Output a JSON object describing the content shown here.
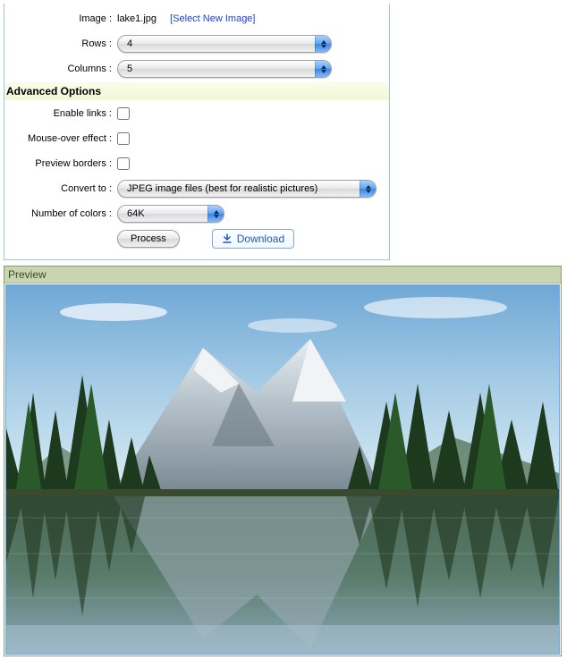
{
  "labels": {
    "image": "Image :",
    "rows": "Rows :",
    "columns": "Columns :",
    "advanced": "Advanced Options",
    "enable_links": "Enable links :",
    "mouseover": "Mouse-over effect :",
    "preview_borders": "Preview borders :",
    "convert_to": "Convert to :",
    "num_colors": "Number of colors :"
  },
  "values": {
    "filename": "lake1.jpg",
    "select_new": "[Select New Image]",
    "rows": "4",
    "columns": "5",
    "convert_to": "JPEG image files (best for realistic pictures)",
    "num_colors": "64K"
  },
  "buttons": {
    "process": "Process",
    "download": "Download"
  },
  "preview": {
    "title": "Preview"
  }
}
